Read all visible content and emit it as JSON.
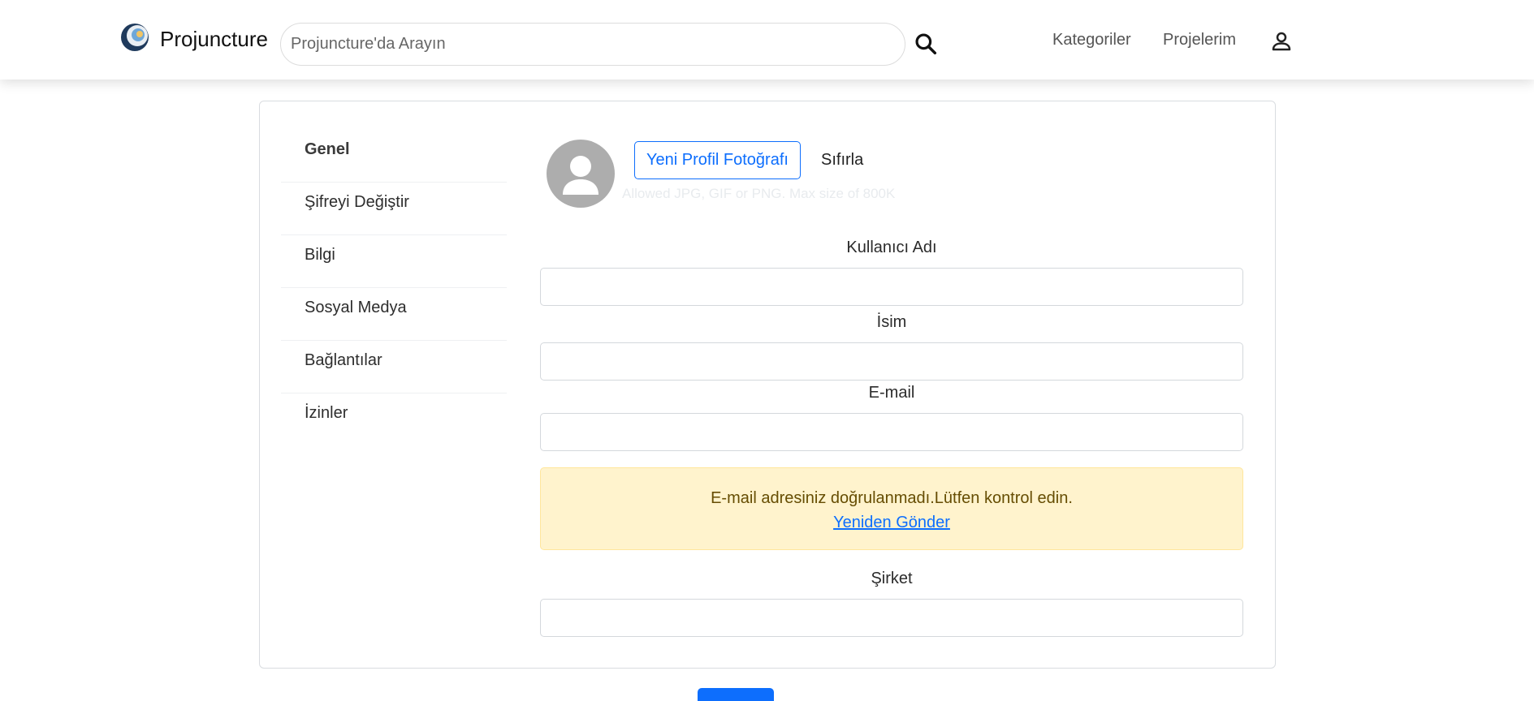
{
  "header": {
    "brand": "Projuncture",
    "search": {
      "placeholder": "Projuncture'da Arayın",
      "value": ""
    },
    "nav": [
      {
        "label": "Kategoriler"
      },
      {
        "label": "Projelerim"
      }
    ]
  },
  "sidebar": {
    "items": [
      {
        "label": "Genel",
        "active": true
      },
      {
        "label": "Şifreyi Değiştir"
      },
      {
        "label": "Bilgi"
      },
      {
        "label": "Sosyal Medya"
      },
      {
        "label": "Bağlantılar"
      },
      {
        "label": "İzinler"
      }
    ]
  },
  "profile": {
    "upload_label": "Yeni Profil Fotoğrafı",
    "reset_label": "Sıfırla",
    "hint": "Allowed JPG, GIF or PNG. Max size of 800K"
  },
  "form": {
    "username": {
      "label": "Kullanıcı Adı",
      "value": ""
    },
    "name": {
      "label": "İsim",
      "value": ""
    },
    "email": {
      "label": "E-mail",
      "value": ""
    },
    "company": {
      "label": "Şirket",
      "value": ""
    }
  },
  "alert": {
    "message": "E-mail adresiniz doğrulanmadı.Lütfen kontrol edin.",
    "link": "Yeniden Gönder"
  },
  "colors": {
    "accent": "#0d6efd",
    "alert_bg": "#fff3cd",
    "alert_text": "#664d03",
    "avatar_bg": "#adadad"
  },
  "icons": {
    "logo": "projuncture-logo",
    "search": "search-icon",
    "user": "user-icon",
    "avatar": "user-avatar-icon"
  }
}
